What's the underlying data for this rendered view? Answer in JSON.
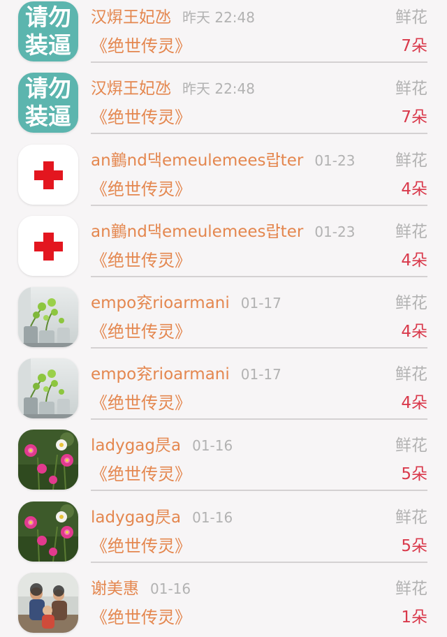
{
  "records": [
    {
      "avatar": {
        "kind": "text",
        "line1": "请勿",
        "line2": "装逼",
        "bg": "#5cb5ae"
      },
      "username": "汉焺王妃氹",
      "time": "昨天 22:48",
      "book": "《绝世传灵》",
      "gift": "鲜花",
      "count": "7朵"
    },
    {
      "avatar": {
        "kind": "text",
        "line1": "请勿",
        "line2": "装逼",
        "bg": "#5cb5ae"
      },
      "username": "汉焺王妃氹",
      "time": "昨天 22:48",
      "book": "《绝世传灵》",
      "gift": "鲜花",
      "count": "7朵"
    },
    {
      "avatar": {
        "kind": "red-cross-icon"
      },
      "username": "an䴀nd댁emeulemees랍ter",
      "time": "01-23",
      "book": "《绝世传灵》",
      "gift": "鲜花",
      "count": "4朵"
    },
    {
      "avatar": {
        "kind": "red-cross-icon"
      },
      "username": "an䴀nd댁emeulemees랍ter",
      "time": "01-23",
      "book": "《绝世传灵》",
      "gift": "鲜花",
      "count": "4朵"
    },
    {
      "avatar": {
        "kind": "plant-photo"
      },
      "username": "empo兖rioarmani",
      "time": "01-17",
      "book": "《绝世传灵》",
      "gift": "鲜花",
      "count": "4朵"
    },
    {
      "avatar": {
        "kind": "plant-photo"
      },
      "username": "empo兖rioarmani",
      "time": "01-17",
      "book": "《绝世传灵》",
      "gift": "鲜花",
      "count": "4朵"
    },
    {
      "avatar": {
        "kind": "flower-photo"
      },
      "username": "ladygag昃a",
      "time": "01-16",
      "book": "《绝世传灵》",
      "gift": "鲜花",
      "count": "5朵"
    },
    {
      "avatar": {
        "kind": "flower-photo"
      },
      "username": "ladygag昃a",
      "time": "01-16",
      "book": "《绝世传灵》",
      "gift": "鲜花",
      "count": "5朵"
    },
    {
      "avatar": {
        "kind": "family-photo"
      },
      "username": "谢美惠",
      "time": "01-16",
      "book": "《绝世传灵》",
      "gift": "鲜花",
      "count": "1朵"
    }
  ],
  "colors": {
    "username": "#e4874f",
    "time": "#b2b2b2",
    "count": "#d9394b",
    "divider": "#d4d1d2"
  }
}
